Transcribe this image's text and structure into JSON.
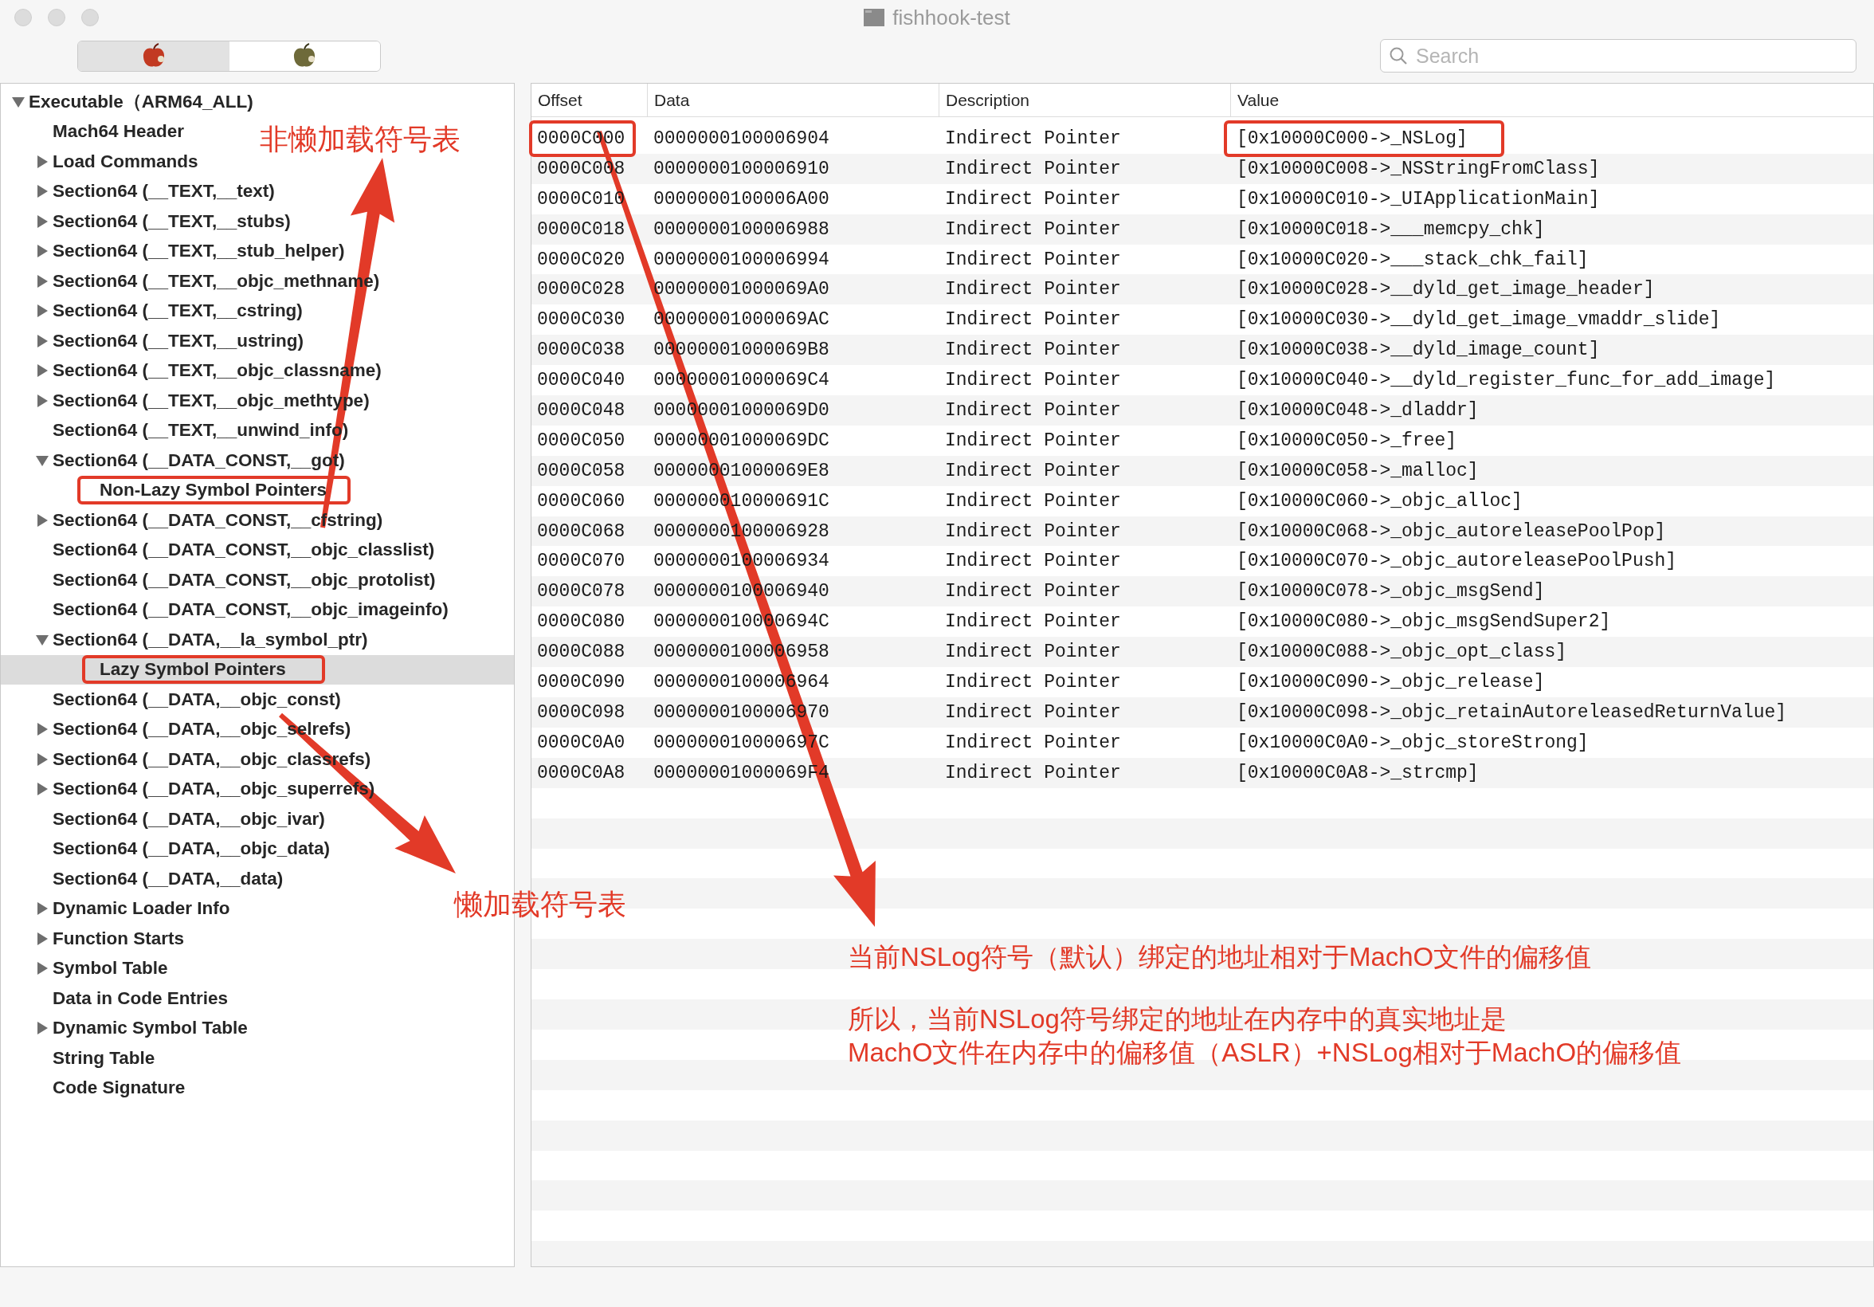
{
  "window": {
    "title": "fishhook-test"
  },
  "toolbar": {
    "segments": [
      {
        "kind": "red-apple",
        "selected": true
      },
      {
        "kind": "olive-apple",
        "selected": false
      }
    ],
    "search": {
      "placeholder": "Search"
    }
  },
  "tree": [
    {
      "label": "Executable（ARM64_ALL)",
      "expanded": true,
      "selected": false,
      "children": [
        {
          "label": "Mach64 Header",
          "selected": false
        },
        {
          "label": "Load Commands",
          "expanded": false,
          "selected": false
        },
        {
          "label": "Section64 (__TEXT,__text)",
          "expanded": false,
          "selected": false
        },
        {
          "label": "Section64 (__TEXT,__stubs)",
          "expanded": false,
          "selected": false
        },
        {
          "label": "Section64 (__TEXT,__stub_helper)",
          "expanded": false,
          "selected": false
        },
        {
          "label": "Section64 (__TEXT,__objc_methname)",
          "expanded": false,
          "selected": false
        },
        {
          "label": "Section64 (__TEXT,__cstring)",
          "expanded": false,
          "selected": false
        },
        {
          "label": "Section64 (__TEXT,__ustring)",
          "expanded": false,
          "selected": false
        },
        {
          "label": "Section64 (__TEXT,__objc_classname)",
          "expanded": false,
          "selected": false
        },
        {
          "label": "Section64 (__TEXT,__objc_methtype)",
          "expanded": false,
          "selected": false
        },
        {
          "label": "Section64 (__TEXT,__unwind_info)",
          "selected": false
        },
        {
          "label": "Section64 (__DATA_CONST,__got)",
          "expanded": true,
          "selected": false,
          "children": [
            {
              "label": "Non-Lazy Symbol Pointers",
              "selected": false
            }
          ]
        },
        {
          "label": "Section64 (__DATA_CONST,__cfstring)",
          "expanded": false,
          "selected": false
        },
        {
          "label": "Section64 (__DATA_CONST,__objc_classlist)",
          "selected": false
        },
        {
          "label": "Section64 (__DATA_CONST,__objc_protolist)",
          "selected": false
        },
        {
          "label": "Section64 (__DATA_CONST,__objc_imageinfo)",
          "selected": false
        },
        {
          "label": "Section64 (__DATA,__la_symbol_ptr)",
          "expanded": true,
          "selected": false,
          "children": [
            {
              "label": "Lazy Symbol Pointers",
              "selected": true
            }
          ]
        },
        {
          "label": "Section64 (__DATA,__objc_const)",
          "selected": false
        },
        {
          "label": "Section64 (__DATA,__objc_selrefs)",
          "expanded": false,
          "selected": false
        },
        {
          "label": "Section64 (__DATA,__objc_classrefs)",
          "expanded": false,
          "selected": false
        },
        {
          "label": "Section64 (__DATA,__objc_superrefs)",
          "expanded": false,
          "selected": false
        },
        {
          "label": "Section64 (__DATA,__objc_ivar)",
          "selected": false
        },
        {
          "label": "Section64 (__DATA,__objc_data)",
          "selected": false
        },
        {
          "label": "Section64 (__DATA,__data)",
          "selected": false
        },
        {
          "label": "Dynamic Loader Info",
          "expanded": false,
          "selected": false
        },
        {
          "label": "Function Starts",
          "expanded": false,
          "selected": false
        },
        {
          "label": "Symbol Table",
          "expanded": false,
          "selected": false
        },
        {
          "label": "Data in Code Entries",
          "selected": false
        },
        {
          "label": "Dynamic Symbol Table",
          "expanded": false,
          "selected": false
        },
        {
          "label": "String Table",
          "selected": false
        },
        {
          "label": "Code Signature",
          "selected": false
        }
      ]
    }
  ],
  "table": {
    "columns": [
      "Offset",
      "Data",
      "Description",
      "Value"
    ],
    "rows": [
      [
        "0000C000",
        "0000000100006904",
        "Indirect Pointer",
        "[0x10000C000->_NSLog]"
      ],
      [
        "0000C008",
        "0000000100006910",
        "Indirect Pointer",
        "[0x10000C008->_NSStringFromClass]"
      ],
      [
        "0000C010",
        "0000000100006A00",
        "Indirect Pointer",
        "[0x10000C010->_UIApplicationMain]"
      ],
      [
        "0000C018",
        "0000000100006988",
        "Indirect Pointer",
        "[0x10000C018->___memcpy_chk]"
      ],
      [
        "0000C020",
        "0000000100006994",
        "Indirect Pointer",
        "[0x10000C020->___stack_chk_fail]"
      ],
      [
        "0000C028",
        "00000001000069A0",
        "Indirect Pointer",
        "[0x10000C028->__dyld_get_image_header]"
      ],
      [
        "0000C030",
        "00000001000069AC",
        "Indirect Pointer",
        "[0x10000C030->__dyld_get_image_vmaddr_slide]"
      ],
      [
        "0000C038",
        "00000001000069B8",
        "Indirect Pointer",
        "[0x10000C038->__dyld_image_count]"
      ],
      [
        "0000C040",
        "00000001000069C4",
        "Indirect Pointer",
        "[0x10000C040->__dyld_register_func_for_add_image]"
      ],
      [
        "0000C048",
        "00000001000069D0",
        "Indirect Pointer",
        "[0x10000C048->_dladdr]"
      ],
      [
        "0000C050",
        "00000001000069DC",
        "Indirect Pointer",
        "[0x10000C050->_free]"
      ],
      [
        "0000C058",
        "00000001000069E8",
        "Indirect Pointer",
        "[0x10000C058->_malloc]"
      ],
      [
        "0000C060",
        "000000010000691C",
        "Indirect Pointer",
        "[0x10000C060->_objc_alloc]"
      ],
      [
        "0000C068",
        "0000000100006928",
        "Indirect Pointer",
        "[0x10000C068->_objc_autoreleasePoolPop]"
      ],
      [
        "0000C070",
        "0000000100006934",
        "Indirect Pointer",
        "[0x10000C070->_objc_autoreleasePoolPush]"
      ],
      [
        "0000C078",
        "0000000100006940",
        "Indirect Pointer",
        "[0x10000C078->_objc_msgSend]"
      ],
      [
        "0000C080",
        "000000010000694C",
        "Indirect Pointer",
        "[0x10000C080->_objc_msgSendSuper2]"
      ],
      [
        "0000C088",
        "0000000100006958",
        "Indirect Pointer",
        "[0x10000C088->_objc_opt_class]"
      ],
      [
        "0000C090",
        "0000000100006964",
        "Indirect Pointer",
        "[0x10000C090->_objc_release]"
      ],
      [
        "0000C098",
        "0000000100006970",
        "Indirect Pointer",
        "[0x10000C098->_objc_retainAutoreleasedReturnValue]"
      ],
      [
        "0000C0A0",
        "000000010000697C",
        "Indirect Pointer",
        "[0x10000C0A0->_objc_storeStrong]"
      ],
      [
        "0000C0A8",
        "00000001000069F4",
        "Indirect Pointer",
        "[0x10000C0A8->_strcmp]"
      ]
    ]
  },
  "annotations": [
    {
      "kind": "label",
      "text": "非懒加载符号表"
    },
    {
      "kind": "label",
      "text": "懒加载符号表"
    },
    {
      "kind": "label",
      "text": "当前NSLog符号（默认）绑定的地址相对于MachO文件的偏移值"
    },
    {
      "kind": "note",
      "lines": [
        "所以，当前NSLog符号绑定的地址在内存中的真实地址是",
        "MachO文件在内存中的偏移值（ASLR）+NSLog相对于MachO的偏移值"
      ]
    }
  ]
}
